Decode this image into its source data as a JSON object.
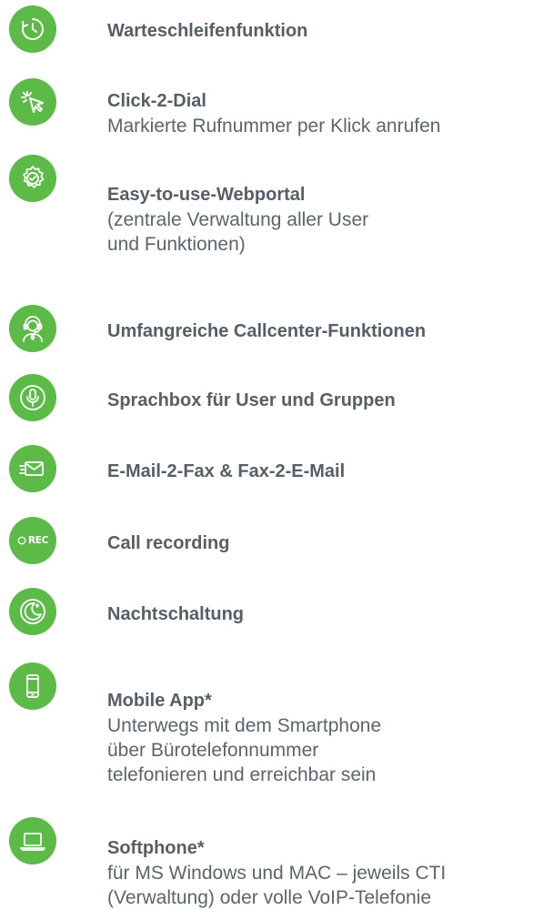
{
  "brand": {
    "accent": "#5cba47",
    "text": "#555f66"
  },
  "features": [
    {
      "icon": "clock-icon",
      "title": "Warteschleifenfunktion",
      "description": ""
    },
    {
      "icon": "cursor-click-icon",
      "title": "Click-2-Dial",
      "description": "Markierte Rufnummer per Klick anrufen"
    },
    {
      "icon": "gear-check-icon",
      "title": "Easy-to-use-Webportal",
      "description": "(zentrale Verwaltung aller User\nund Funktionen)"
    },
    {
      "icon": "headset-agent-icon",
      "title": "Umfangreiche Callcenter-Funktionen",
      "description": ""
    },
    {
      "icon": "microphone-icon",
      "title": "Sprachbox für User und Gruppen",
      "description": ""
    },
    {
      "icon": "fax-mail-icon",
      "title": "E-Mail-2-Fax & Fax-2-E-Mail",
      "description": ""
    },
    {
      "icon": "record-icon",
      "icon_text": "REC",
      "title": "Call recording",
      "description": ""
    },
    {
      "icon": "moon-icon",
      "title": "Nachtschaltung",
      "description": ""
    },
    {
      "icon": "smartphone-icon",
      "title": "Mobile App*",
      "description": "Unterwegs mit dem Smartphone\nüber Bürotelefonnummer\ntelefonieren und erreichbar sein"
    },
    {
      "icon": "laptop-icon",
      "title": "Softphone*",
      "description": "für MS Windows und MAC –  jeweils CTI\n(Verwaltung) oder volle VoIP-Telefonie"
    }
  ]
}
